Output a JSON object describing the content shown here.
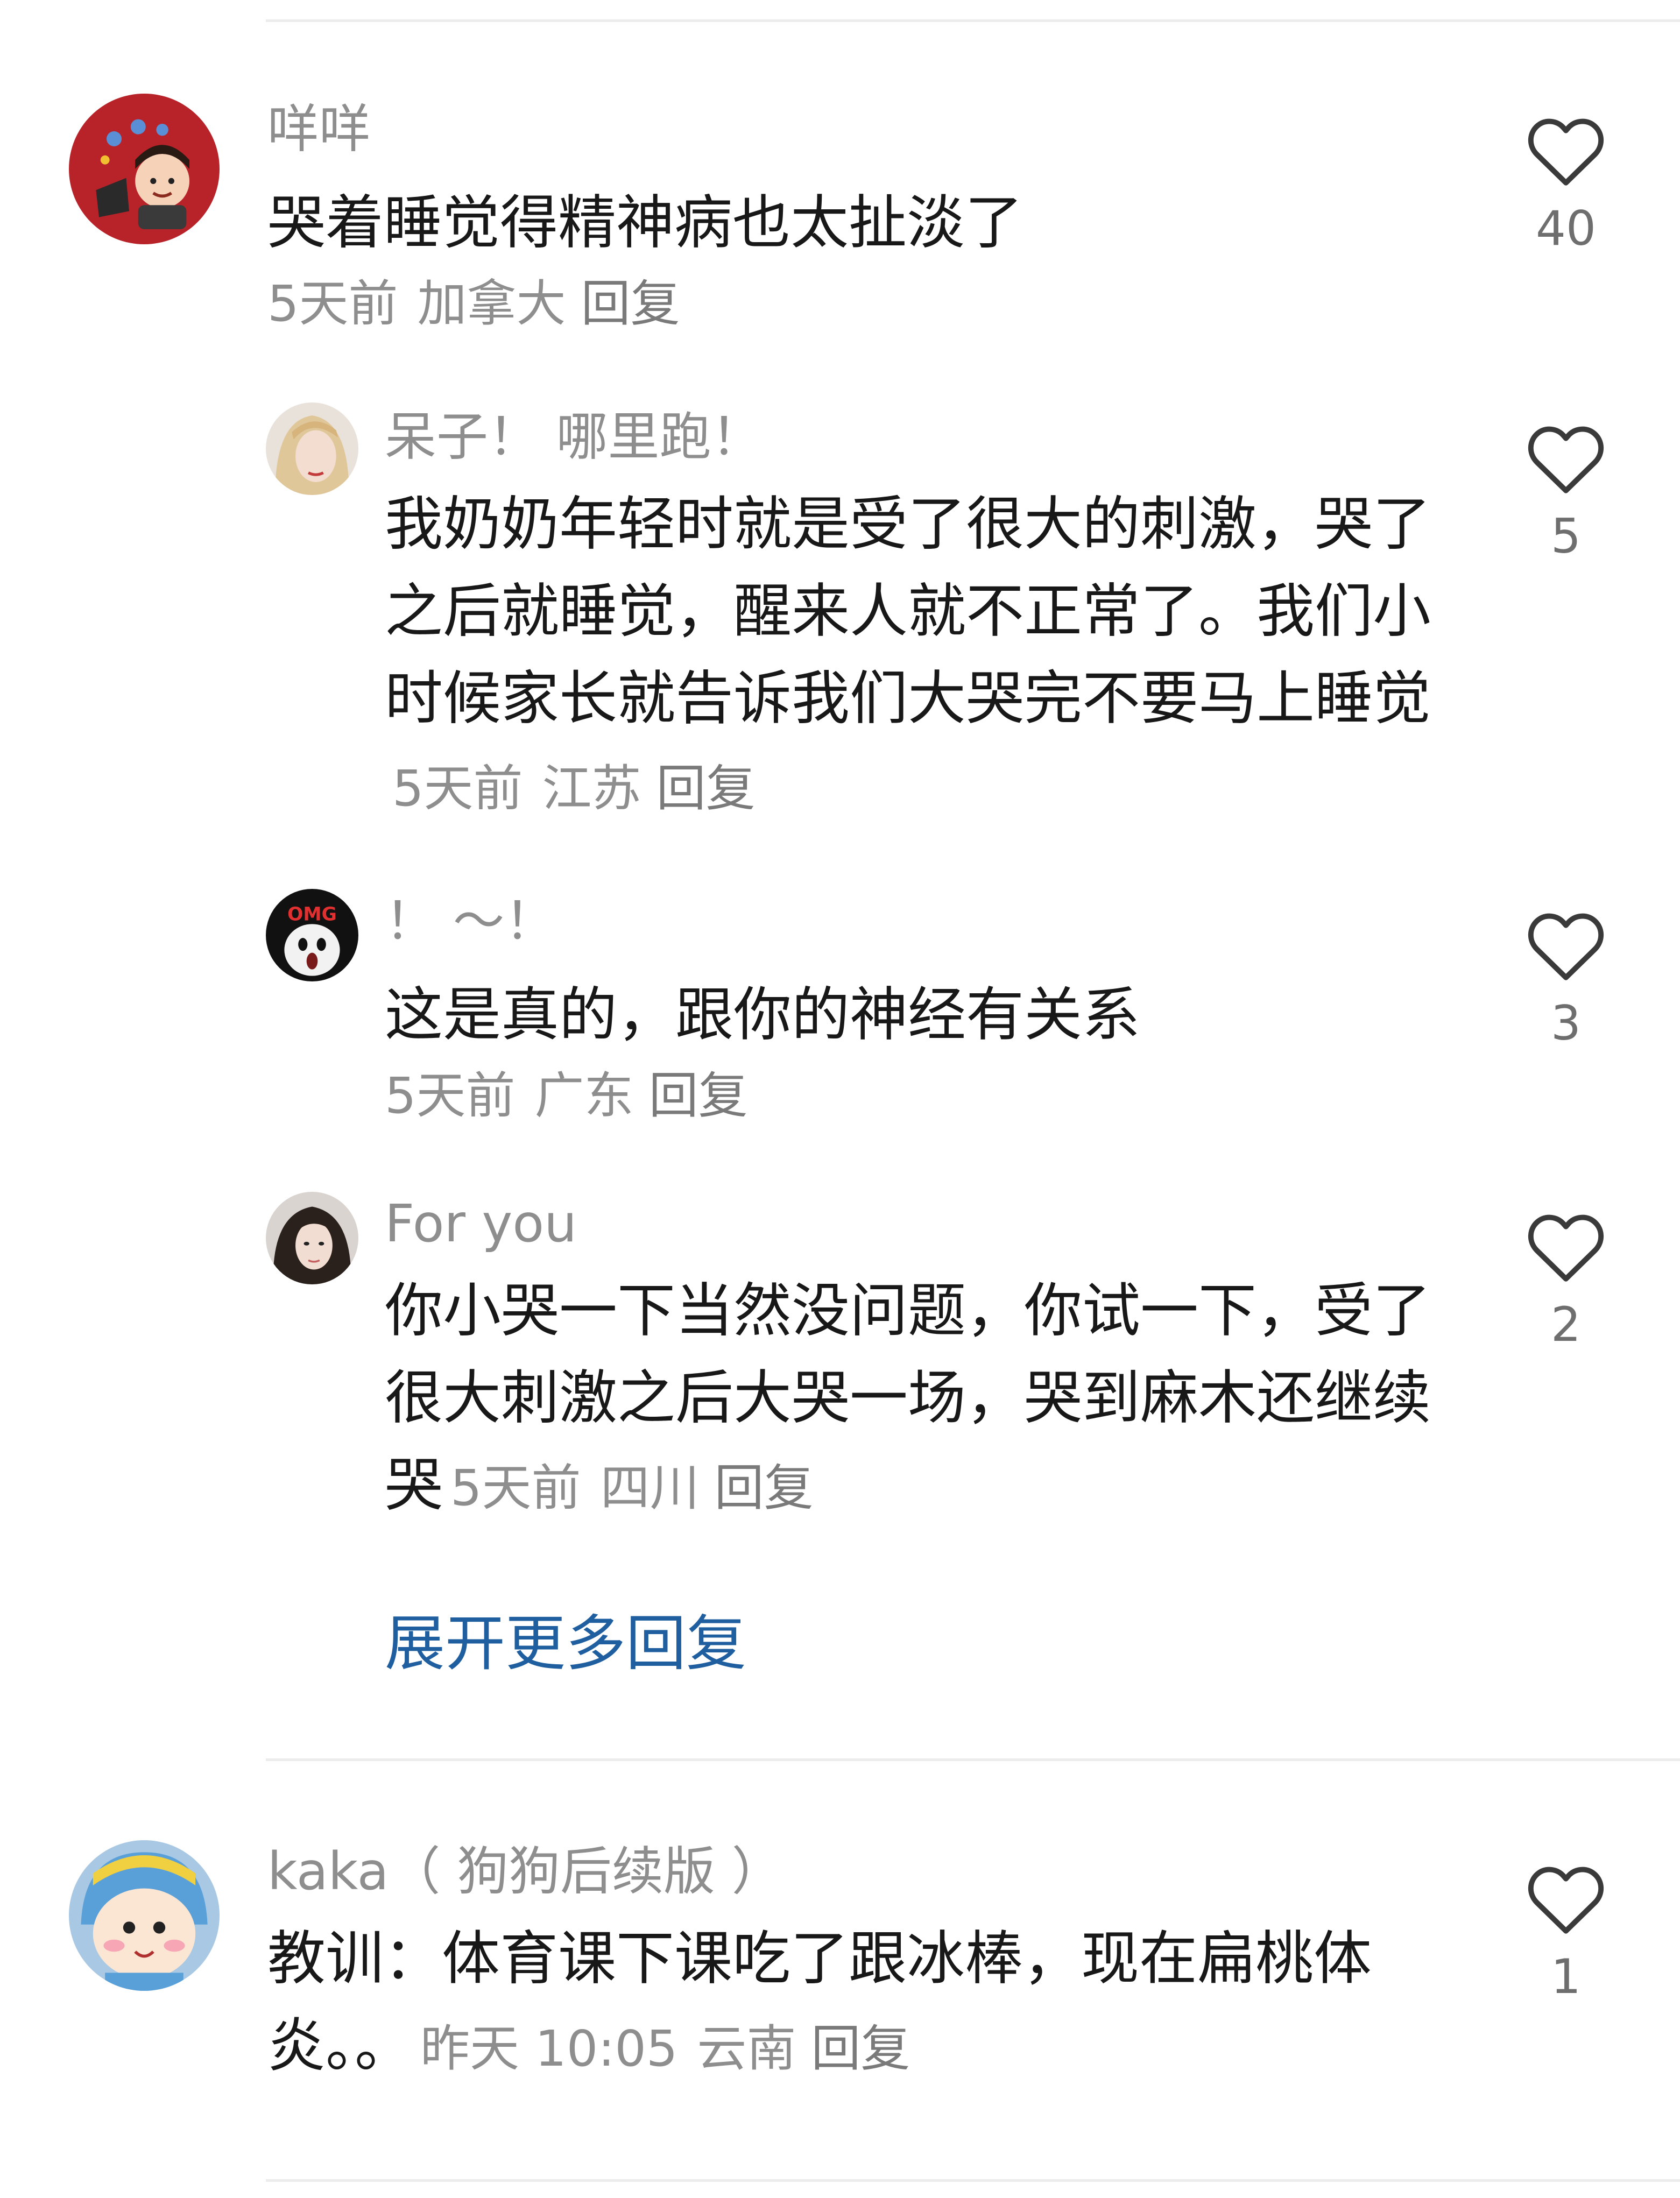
{
  "comments": [
    {
      "username": "咩咩",
      "text": "哭着睡觉得精神病也太扯淡了",
      "time": "5天前",
      "location": "加拿大",
      "reply_label": "回复",
      "likes": "40"
    }
  ],
  "replies": [
    {
      "username": "呆子！ 哪里跑！",
      "text": "我奶奶年轻时就是受了很大的刺激，哭了之后就睡觉，醒来人就不正常了。我们小时候家长就告诉我们大哭完不要马上睡觉",
      "time": "5天前",
      "location": "江苏",
      "reply_label": "回复",
      "likes": "5"
    },
    {
      "username": "！ ～！",
      "avatar_text": "OMG",
      "text": "这是真的，跟你的神经有关系",
      "time": "5天前",
      "location": "广东",
      "reply_label": "回复",
      "likes": "3"
    },
    {
      "username": "For you",
      "text": "你小哭一下当然没问题，你试一下，受了很大刺激之后大哭一场，哭到麻木还继续哭",
      "time": "5天前",
      "location": "四川",
      "reply_label": "回复",
      "likes": "2"
    }
  ],
  "expand_replies_label": "展开更多回复",
  "second_comment": {
    "username": "kaka（ 狗狗后续版 ）",
    "text": "教训：体育课下课吃了跟冰棒，现在扁桃体炎。。",
    "time": "昨天 10:05",
    "location": "云南",
    "reply_label": "回复",
    "likes": "1"
  },
  "colors": {
    "link_blue": "#1f5fa0",
    "meta_gray": "#8e8e8e",
    "divider": "#ececec"
  },
  "icons": {
    "like": "heart-outline-icon"
  }
}
